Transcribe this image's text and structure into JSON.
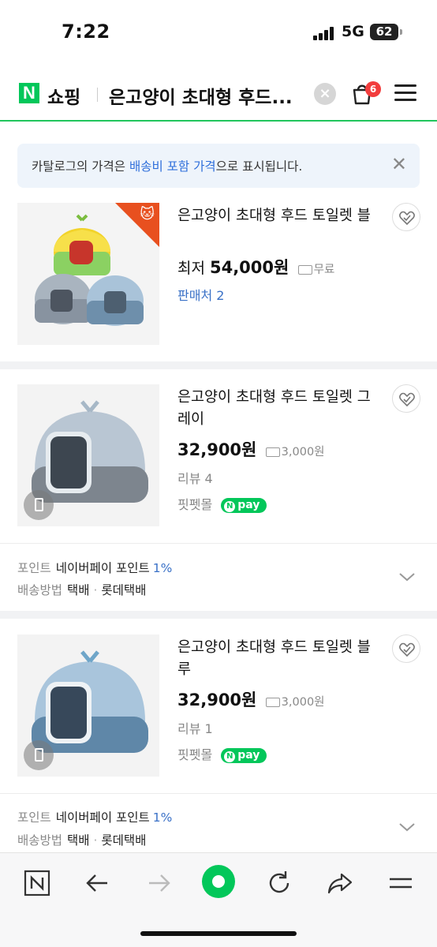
{
  "status_bar": {
    "time": "7:22",
    "network": "5G",
    "battery": "62"
  },
  "header": {
    "logo": "N",
    "service": "쇼핑",
    "title": "은고양이 초대형 후드...",
    "cart_count": "6"
  },
  "notice": {
    "text_before": "카탈로그의 가격은 ",
    "highlight": "배송비 포함 가격",
    "text_after": "으로 표시됩니다."
  },
  "products": [
    {
      "name": "은고양이 초대형 후드 토일렛 블",
      "price_prefix": "최저",
      "price": "54,000원",
      "shipping": "무료",
      "sellers": "판매처 2"
    },
    {
      "name": "은고양이 초대형 후드 토일렛 그레이",
      "price": "32,900원",
      "shipping": "3,000원",
      "reviews": "리뷰 4",
      "store": "핏펫몰",
      "pay_badge": "pay",
      "meta": {
        "point_label": "포인트",
        "point_value": "네이버페이 포인트",
        "point_pct": "1%",
        "ship_label": "배송방법",
        "ship_value": "택배",
        "ship_courier": "롯데택배"
      }
    },
    {
      "name": "은고양이 초대형 후드 토일렛 블루",
      "price": "32,900원",
      "shipping": "3,000원",
      "reviews": "리뷰 1",
      "store": "핏펫몰",
      "pay_badge": "pay",
      "meta": {
        "point_label": "포인트",
        "point_value": "네이버페이 포인트",
        "point_pct": "1%",
        "ship_label": "배송방법",
        "ship_value": "택배",
        "ship_courier": "롯데택배"
      }
    }
  ],
  "colors": {
    "brand_green": "#03c75a",
    "link_blue": "#3a71c7",
    "badge_red": "#f23d3d"
  },
  "toolbar_icons": [
    "naver-home-icon",
    "back-arrow-icon",
    "forward-arrow-icon",
    "green-dot-home-icon",
    "reload-icon",
    "share-icon",
    "menu-icon"
  ]
}
